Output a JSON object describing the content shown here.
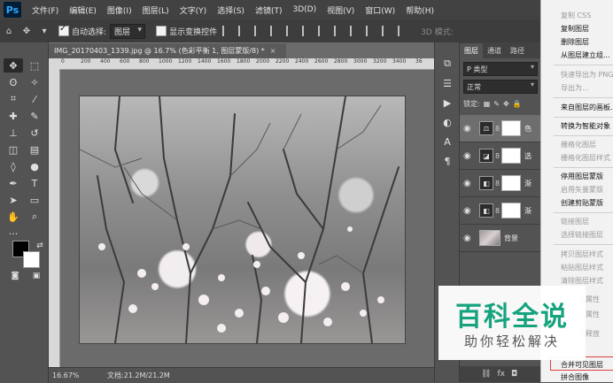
{
  "app": {
    "logo": "Ps"
  },
  "menubar": [
    "文件(F)",
    "编辑(E)",
    "图像(I)",
    "图层(L)",
    "文字(Y)",
    "选择(S)",
    "滤镜(T)",
    "3D(D)",
    "视图(V)",
    "窗口(W)",
    "帮助(H)"
  ],
  "options": {
    "auto_select_label": "自动选择:",
    "auto_select_checked": true,
    "target": "图层",
    "transform_label": "显示变换控件",
    "transform_checked": false,
    "mode_3d": "3D 模式:"
  },
  "document": {
    "tab_title": "IMG_20170403_1339.jpg @ 16.7% (色彩平衡 1, 图层蒙版/8) *",
    "close_glyph": "×",
    "ruler_ticks": [
      "0",
      "200",
      "400",
      "600",
      "800",
      "1000",
      "1200",
      "1400",
      "1600",
      "1800",
      "2000",
      "2200",
      "2400",
      "2600",
      "2800",
      "3000",
      "3200",
      "3400",
      "36"
    ],
    "zoom": "16.67%",
    "doc_info": "文档:21.2M/21.2M"
  },
  "layers_panel": {
    "tabs": [
      "图层",
      "通道",
      "路径"
    ],
    "filter": "P 类型",
    "blend_mode": "正常",
    "lock_label": "锁定:",
    "layers": [
      {
        "name": "色",
        "icon": "scale-icon",
        "selected": true
      },
      {
        "name": "选",
        "icon": "levels-icon",
        "selected": false
      },
      {
        "name": "渐",
        "icon": "gradient-icon",
        "selected": false
      },
      {
        "name": "渐",
        "icon": "gradient-icon",
        "selected": false
      },
      {
        "name": "背景",
        "icon": "photo-thumb",
        "selected": false
      }
    ],
    "footer_icons": [
      "link-icon",
      "fx-icon",
      "mask-icon"
    ]
  },
  "context_menu": {
    "items": [
      {
        "label": "复制 CSS",
        "enabled": false
      },
      {
        "label": "复制图层",
        "enabled": true
      },
      {
        "label": "删除图层",
        "enabled": true
      },
      {
        "label": "从图层建立组...",
        "enabled": true
      },
      {
        "label": "快速导出为 PNG",
        "enabled": false
      },
      {
        "label": "导出为...",
        "enabled": false
      },
      {
        "label": "来自图层的画板...",
        "enabled": true
      },
      {
        "label": "转换为智能对象",
        "enabled": true
      },
      {
        "label": "栅格化图层",
        "enabled": false
      },
      {
        "label": "栅格化图层样式",
        "enabled": false
      },
      {
        "label": "停用图层蒙版",
        "enabled": true
      },
      {
        "label": "启用矢量蒙版",
        "enabled": false
      },
      {
        "label": "创建剪贴蒙版",
        "enabled": true
      },
      {
        "label": "链接图层",
        "enabled": false
      },
      {
        "label": "选择链接图层",
        "enabled": false
      },
      {
        "label": "拷贝图层样式",
        "enabled": false
      },
      {
        "label": "粘贴图层样式",
        "enabled": false
      },
      {
        "label": "清除图层样式",
        "enabled": false
      },
      {
        "label": "层属性",
        "enabled": false
      },
      {
        "label": "层属性",
        "enabled": false
      },
      {
        "label": "层释放",
        "enabled": false
      },
      {
        "label": "合并可见图层",
        "enabled": true
      },
      {
        "label": "拼合图像",
        "enabled": true
      }
    ]
  },
  "watermark": {
    "main": "百科全说",
    "sub": "助你轻松解决"
  }
}
